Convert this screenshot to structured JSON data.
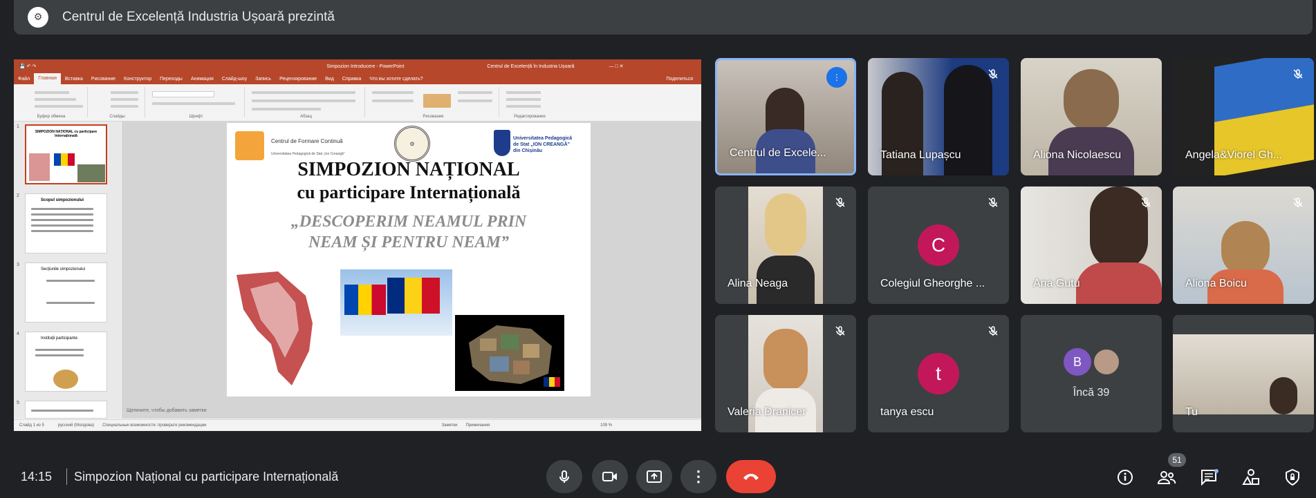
{
  "meeting": {
    "presenter_banner": "Centrul de Excelență Industria Ușoară prezintă",
    "time": "14:15",
    "title": "Simpozion Național cu participare Internațională",
    "participants_count": "51",
    "more_count_label": "Încă 39"
  },
  "powerpoint": {
    "doc_title": "Simpozion Introducere - PowerPoint",
    "account": "Centrul de Excelență în Industria Ușoară",
    "share_label": "Поделиться",
    "tabs": [
      "Файл",
      "Главная",
      "Вставка",
      "Рисование",
      "Конструктор",
      "Переходы",
      "Анимация",
      "Слайд-шоу",
      "Запись",
      "Рецензирование",
      "Вид",
      "Справка"
    ],
    "tell_me": "Что вы хотите сделать?",
    "ribbon_groups": [
      "Буфер обмена",
      "Слайды",
      "Шрифт",
      "Абзац",
      "Рисование",
      "Редактирование"
    ],
    "notes_placeholder": "Щелкните, чтобы добавить заметки",
    "status_left": "Слайд 1 из 5",
    "status_lang": "русский (Молдова)",
    "status_access": "Специальные возможности: проверьте рекомендации",
    "status_notes": "Заметки",
    "status_comments": "Примечания",
    "zoom": "109 %"
  },
  "slide": {
    "logo_left": "Centrul de Formare Continuă",
    "logo_left_sub": "Universitatea Pedagogică de Stat „Ion Creangă”",
    "logo_right_1": "Universitatea Pedagogică",
    "logo_right_2": "de Stat „ION CREANGĂ”",
    "logo_right_3": "din Chișinău",
    "heading_1": "SIMPOZION NAȚIONAL",
    "heading_2": "cu participare Internațională",
    "quote_1": "„DESCOPERIM NEAMUL PRIN",
    "quote_2": "NEAM ȘI PENTRU NEAM”"
  },
  "thumbnails": [
    {
      "num": "1",
      "title": "SIMPOZION NAȚIONAL cu participare Internațională"
    },
    {
      "num": "2",
      "title": "Scopul simpozionului"
    },
    {
      "num": "3",
      "title": "Secțiunile simpozionului"
    },
    {
      "num": "4",
      "title": "Instituții participante"
    },
    {
      "num": "5",
      "title": ""
    }
  ],
  "participants": [
    {
      "name": "Centrul de Excele...",
      "speaking": true
    },
    {
      "name": "Tatiana Lupașcu",
      "muted": true
    },
    {
      "name": "Aliona Nicolaescu",
      "muted": false
    },
    {
      "name": "Angela&Viorel Gh...",
      "muted": true
    },
    {
      "name": "Alina Neaga",
      "muted": true
    },
    {
      "name": "Colegiul Gheorghe ...",
      "muted": true,
      "initial": "C"
    },
    {
      "name": "Ana Gutu",
      "muted": true
    },
    {
      "name": "Aliona Boicu",
      "muted": true
    },
    {
      "name": "Valeria Dranicer",
      "muted": true
    },
    {
      "name": "tanya escu",
      "muted": true,
      "initial": "t"
    },
    {
      "name": "Încă 39",
      "initial": "B"
    },
    {
      "name": "Tu"
    }
  ],
  "colors": {
    "accent": "#8ab4f8",
    "hangup": "#ea4335",
    "avatar": "#c2185b",
    "avatar_b": "#7e57c2",
    "ppt_brand": "#b7472a"
  }
}
